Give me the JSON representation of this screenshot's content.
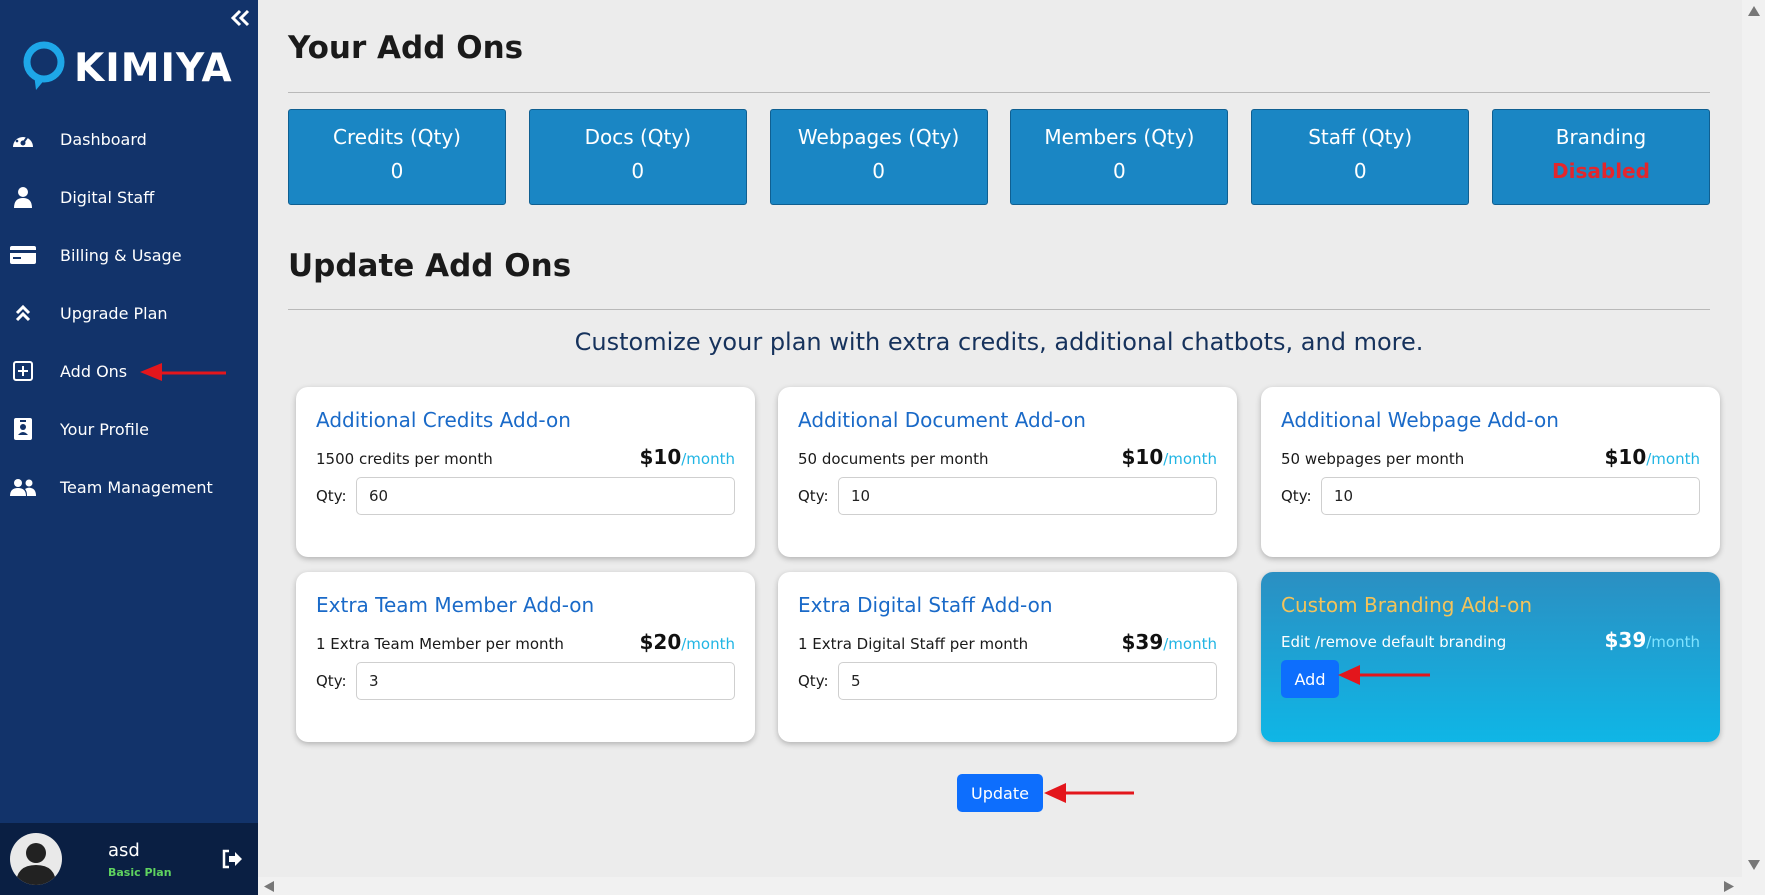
{
  "sidebar": {
    "brand": "KIMIYA",
    "items": [
      {
        "label": "Dashboard",
        "icon": "gauge-icon"
      },
      {
        "label": "Digital Staff",
        "icon": "person-icon"
      },
      {
        "label": "Billing & Usage",
        "icon": "credit-card-icon"
      },
      {
        "label": "Upgrade Plan",
        "icon": "double-chevron-up-icon"
      },
      {
        "label": "Add Ons",
        "icon": "plus-square-icon"
      },
      {
        "label": "Your Profile",
        "icon": "id-badge-icon"
      },
      {
        "label": "Team Management",
        "icon": "users-icon"
      }
    ],
    "user": {
      "name": "asd",
      "plan": "Basic Plan"
    }
  },
  "main": {
    "title": "Your Add Ons",
    "stats": [
      {
        "label": "Credits (Qty)",
        "value": "0"
      },
      {
        "label": "Docs (Qty)",
        "value": "0"
      },
      {
        "label": "Webpages (Qty)",
        "value": "0"
      },
      {
        "label": "Members (Qty)",
        "value": "0"
      },
      {
        "label": "Staff (Qty)",
        "value": "0"
      },
      {
        "label": "Branding",
        "value": "Disabled"
      }
    ],
    "update_title": "Update Add Ons",
    "subtitle": "Customize your plan with extra credits, additional chatbots, and more.",
    "qty_label": "Qty:",
    "cards": [
      {
        "title": "Additional Credits Add-on",
        "desc": "1500 credits per month",
        "price": "$10",
        "per": "/month",
        "qty": "60"
      },
      {
        "title": "Additional Document Add-on",
        "desc": "50 documents per month",
        "price": "$10",
        "per": "/month",
        "qty": "10"
      },
      {
        "title": "Additional Webpage Add-on",
        "desc": "50 webpages per month",
        "price": "$10",
        "per": "/month",
        "qty": "10"
      },
      {
        "title": "Extra Team Member Add-on",
        "desc": "1 Extra Team Member per month",
        "price": "$20",
        "per": "/month",
        "qty": "3"
      },
      {
        "title": "Extra Digital Staff Add-on",
        "desc": "1 Extra Digital Staff per month",
        "price": "$39",
        "per": "/month",
        "qty": "5"
      },
      {
        "title": "Custom Branding Add-on",
        "desc": "Edit /remove default branding",
        "price": "$39",
        "per": "/month",
        "button": "Add"
      }
    ],
    "update_button": "Update"
  },
  "colors": {
    "sidebar_bg": "#12336a",
    "stat_bg": "#1a86c4",
    "card_title": "#1a6ac8",
    "button": "#0d6efd",
    "annotation_arrow": "#e3161c",
    "disabled": "#e3262d"
  }
}
